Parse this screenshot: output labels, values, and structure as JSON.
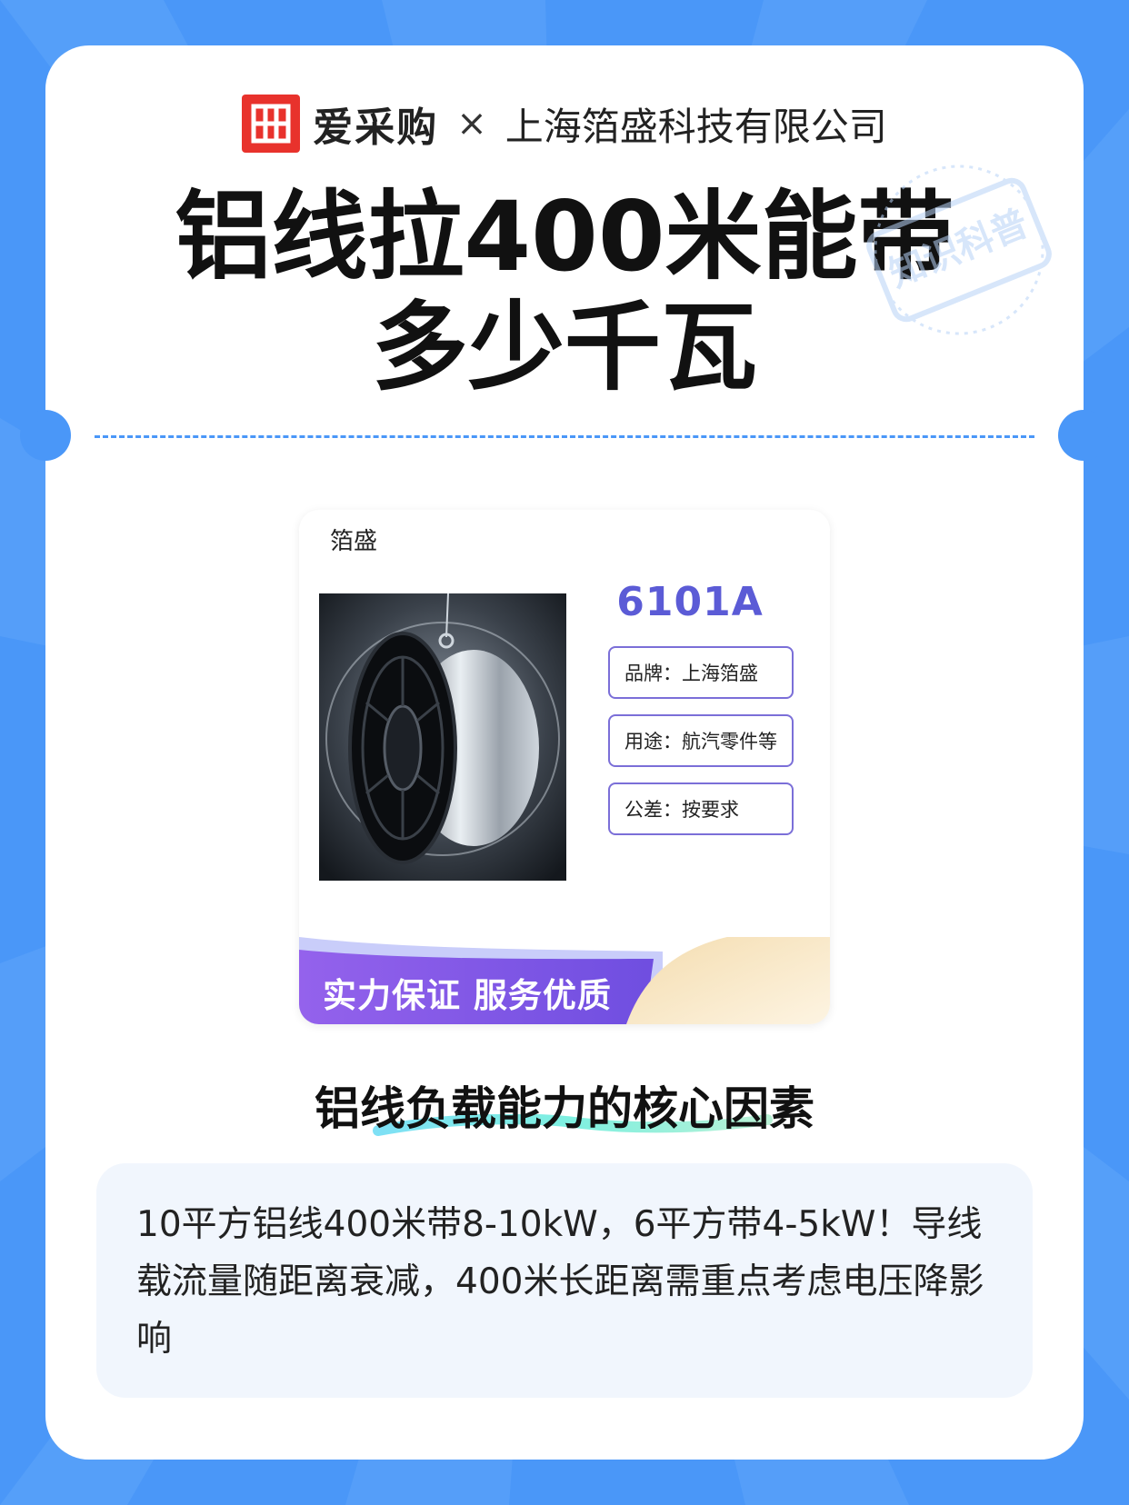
{
  "colors": {
    "background": "#4a97f8",
    "logo_red": "#e8322c",
    "model_purple": "#5b5bd6",
    "spec_border": "#7b6fd8",
    "banner_purple": "#8a5ae8",
    "body_box": "#f1f6fd"
  },
  "header": {
    "logo_icon": "aicaigou-logo-icon",
    "brand_name": "爱采购",
    "separator": "×",
    "company": "上海箔盛科技有限公司"
  },
  "title": {
    "line1": "铝线拉400米能带",
    "line2": "多少千瓦"
  },
  "stamp": {
    "text": "知识科普"
  },
  "product_card": {
    "brand": "箔盛",
    "image": "aluminum-wire-spool-image",
    "model": "6101A",
    "specs": [
      {
        "text": "品牌：上海箔盛"
      },
      {
        "text": "用途：航汽零件等"
      },
      {
        "text": "公差：按要求"
      }
    ],
    "slogan": "实力保证 服务优质"
  },
  "section": {
    "heading": "铝线负载能力的核心因素",
    "body": "10平方铝线400米带8-10kW，6平方带4-5kW！导线载流量随距离衰减，400米长距离需重点考虑电压降影响"
  }
}
